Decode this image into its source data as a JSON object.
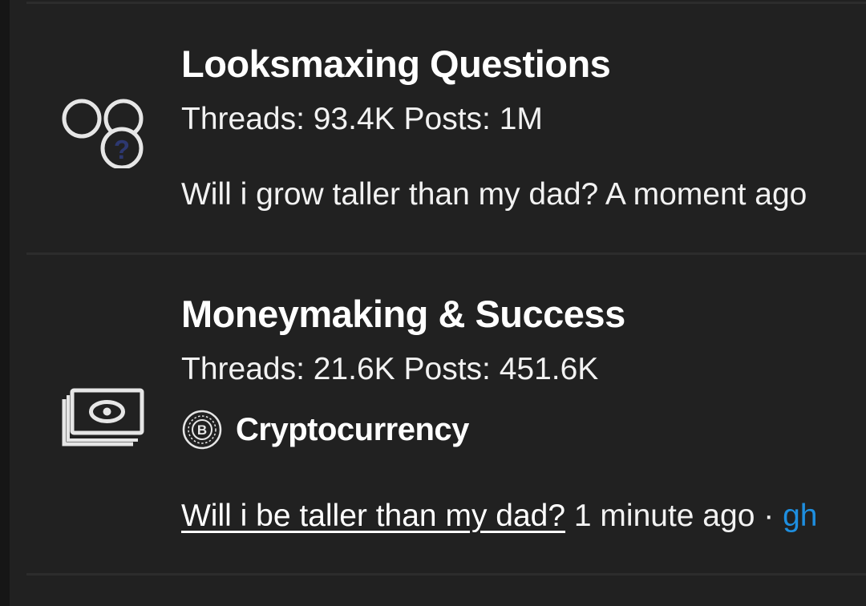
{
  "nodes": [
    {
      "title": "Looksmaxing Questions",
      "icon": "chain-question-icon",
      "stats": "Threads: 93.4K Posts: 1M",
      "latest": {
        "title": "Will i grow taller than my dad?",
        "time": "A moment ago"
      }
    },
    {
      "title": "Moneymaking & Success",
      "icon": "cash-icon",
      "stats": "Threads: 21.6K Posts: 451.6K",
      "subforum": {
        "icon": "bitcoin-icon",
        "label": "Cryptocurrency"
      },
      "latest": {
        "title": "Will i be taller than my dad?",
        "time": "1 minute ago",
        "separator": "·",
        "user": "gh"
      }
    }
  ],
  "colors": {
    "background": "#212121",
    "outer_background": "#161616",
    "divider": "#2c2c2c",
    "text": "#ffffff",
    "link_user": "#1e8fe0",
    "question_mark": "#2d3870"
  }
}
